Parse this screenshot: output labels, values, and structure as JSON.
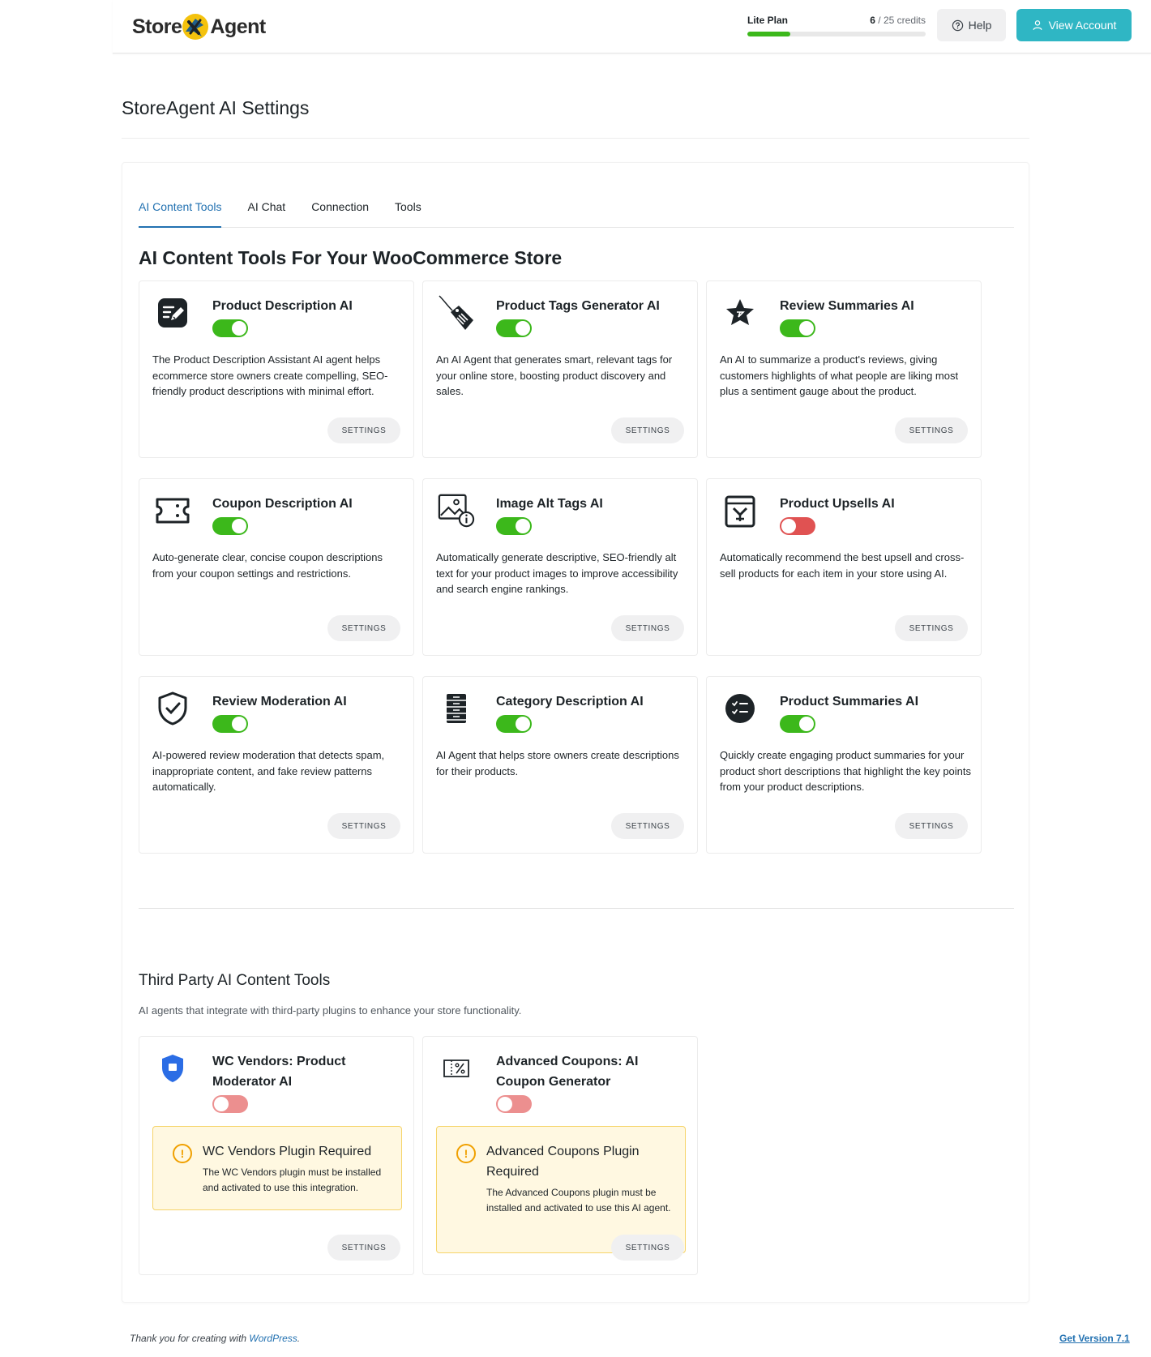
{
  "header": {
    "logo_left": "Store",
    "logo_right": "Agent",
    "plan_name": "Lite Plan",
    "credits_used": "6",
    "credits_total": "/ 25 credits",
    "credits_fraction": 0.24,
    "help_label": "Help",
    "account_label": "View Account"
  },
  "page_title": "StoreAgent AI Settings",
  "tabs": [
    {
      "label": "AI Content Tools",
      "active": true
    },
    {
      "label": "AI Chat",
      "active": false
    },
    {
      "label": "Connection",
      "active": false
    },
    {
      "label": "Tools",
      "active": false
    }
  ],
  "section_title": "AI Content Tools For Your WooCommerce Store",
  "tools": [
    {
      "icon": "edit-document-icon",
      "title": "Product Description AI",
      "enabled": true,
      "description": "The Product Description Assistant AI agent helps ecommerce store owners create compelling, SEO-friendly product descriptions with minimal effort.",
      "button": "SETTINGS"
    },
    {
      "icon": "price-tag-icon",
      "title": "Product Tags Generator AI",
      "enabled": true,
      "description": "An AI Agent that generates smart, relevant tags for your online store, boosting product discovery and sales.",
      "button": "SETTINGS"
    },
    {
      "icon": "star-badge-icon",
      "title": "Review Summaries AI",
      "enabled": true,
      "description": "An AI to summarize a product's reviews, giving customers highlights of what people are liking most plus a sentiment gauge about the product.",
      "button": "SETTINGS"
    },
    {
      "icon": "coupon-ticket-icon",
      "title": "Coupon Description AI",
      "enabled": true,
      "description": "Auto-generate clear, concise coupon descriptions from your coupon settings and restrictions.",
      "button": "SETTINGS"
    },
    {
      "icon": "image-info-icon",
      "title": "Image Alt Tags AI",
      "enabled": true,
      "description": "Automatically generate descriptive, SEO-friendly alt text for your product images to improve accessibility and search engine rankings.",
      "button": "SETTINGS"
    },
    {
      "icon": "shopping-bag-icon",
      "title": "Product Upsells AI",
      "enabled": false,
      "description": "Automatically recommend the best upsell and cross-sell products for each item in your store using AI.",
      "button": "SETTINGS"
    },
    {
      "icon": "shield-check-icon",
      "title": "Review Moderation AI",
      "enabled": true,
      "description": "AI-powered review moderation that detects spam, inappropriate content, and fake review patterns automatically.",
      "button": "SETTINGS"
    },
    {
      "icon": "filing-cabinet-icon",
      "title": "Category Description AI",
      "enabled": true,
      "description": "AI Agent that helps store owners create descriptions for their products.",
      "button": "SETTINGS"
    },
    {
      "icon": "checklist-circle-icon",
      "title": "Product Summaries AI",
      "enabled": true,
      "description": "Quickly create engaging product summaries for your product short descriptions that highlight the key points from your product descriptions.",
      "button": "SETTINGS"
    }
  ],
  "third_party": {
    "title": "Third Party AI Content Tools",
    "subtitle": "AI agents that integrate with third-party plugins to enhance your store functionality.",
    "tools": [
      {
        "icon": "shield-badge-icon",
        "title": "WC Vendors: Product Moderator AI",
        "enabled": false,
        "warning_title": "WC Vendors Plugin Required",
        "warning_text": "The WC Vendors plugin must be installed and activated to use this integration.",
        "button": "SETTINGS"
      },
      {
        "icon": "coupon-percent-icon",
        "title": "Advanced Coupons: AI Coupon Generator",
        "enabled": false,
        "warning_title": "Advanced Coupons Plugin Required",
        "warning_text": "The Advanced Coupons plugin must be installed and activated to use this AI agent.",
        "button": "SETTINGS"
      }
    ]
  },
  "footer": {
    "thanks_prefix": "Thank you for creating with ",
    "thanks_link": "WordPress",
    "thanks_suffix": ".",
    "version": "Get Version 7.1"
  },
  "colors": {
    "accent": "#2fb6c4",
    "link": "#2271b1",
    "toggle_on": "#3cb81b",
    "toggle_off": "#e05252"
  }
}
